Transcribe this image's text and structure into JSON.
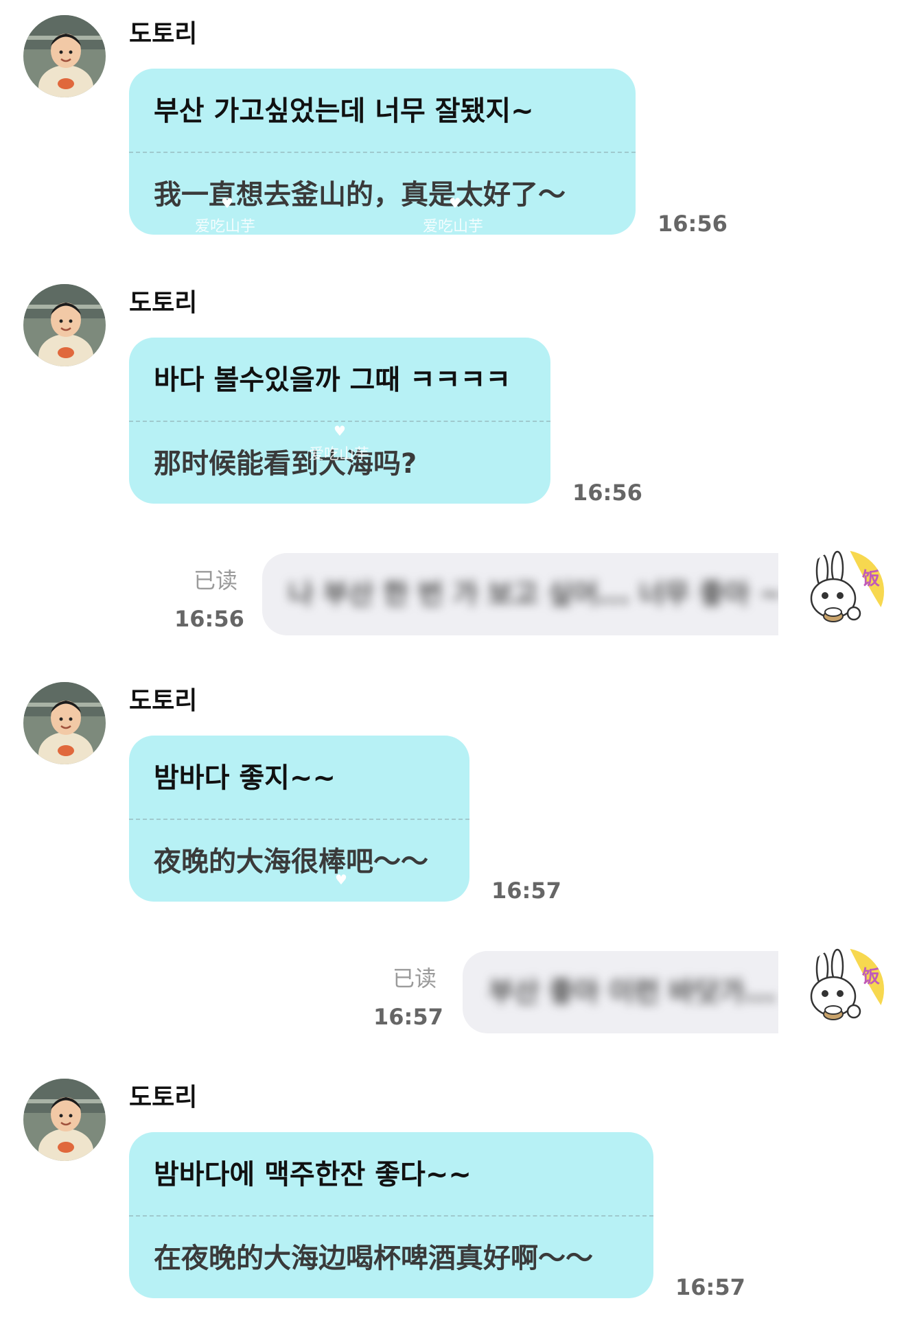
{
  "watermark": "爱吃山芋",
  "messages": [
    {
      "sender": "도토리",
      "korean": "부산 가고싶었는데 너무 잘됐지~",
      "chinese": "我一直想去釜山的，真是太好了～",
      "time": "16:56"
    },
    {
      "sender": "도토리",
      "korean": "바다 볼수있을까 그때 ㅋㅋㅋㅋ",
      "chinese": "那时候能看到大海吗?",
      "time": "16:56"
    },
    {
      "outgoing": true,
      "read_label": "已读",
      "time": "16:56",
      "text": "나 부산 한 번 가 보고 싶어... 너무 좋아 ~~"
    },
    {
      "sender": "도토리",
      "korean": "밤바다 좋지~~",
      "chinese": "夜晚的大海很棒吧～～",
      "time": "16:57"
    },
    {
      "outgoing": true,
      "read_label": "已读",
      "time": "16:57",
      "text": "부산 좋아 이런 바닷가..."
    },
    {
      "sender": "도토리",
      "korean": "밤바다에 맥주한잔 좋다~~",
      "chinese": "在夜晚的大海边喝杯啤酒真好啊～～",
      "time": "16:57"
    }
  ]
}
